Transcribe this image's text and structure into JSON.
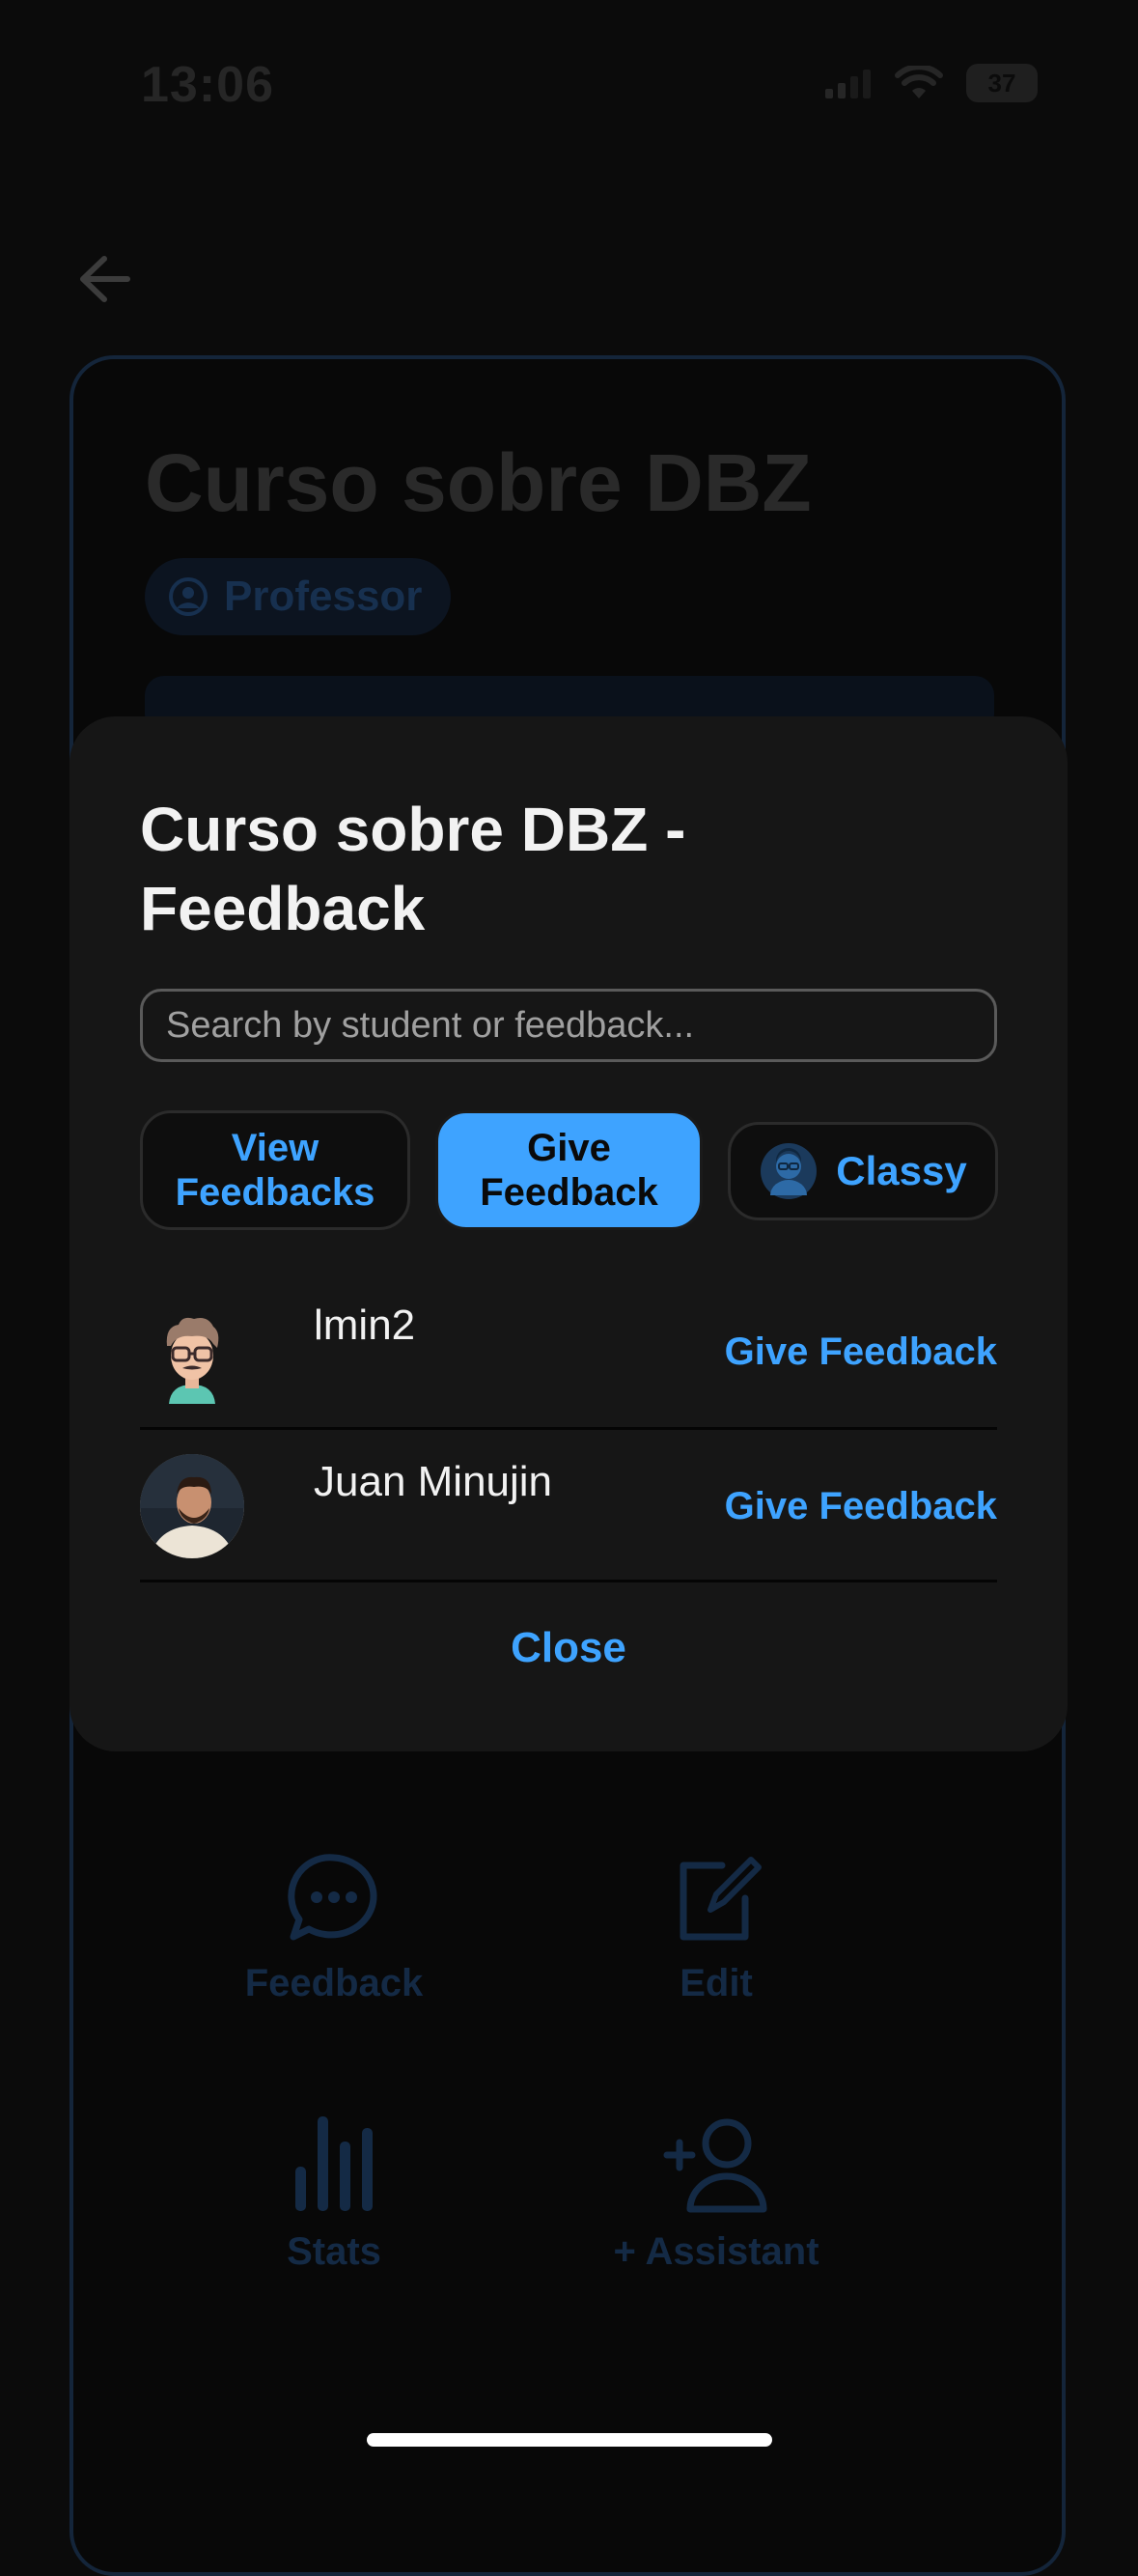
{
  "status_bar": {
    "time": "13:06",
    "battery": "37"
  },
  "course_card": {
    "title": "Curso sobre DBZ",
    "role_chip": "Professor",
    "actions": [
      {
        "label": "Feedback",
        "icon": "chat-bubble-icon"
      },
      {
        "label": "Edit",
        "icon": "edit-icon"
      },
      {
        "label": "Stats",
        "icon": "bar-chart-icon"
      },
      {
        "label": "+ Assistant",
        "icon": "add-user-icon"
      }
    ]
  },
  "modal": {
    "title": "Curso sobre DBZ - Feedback",
    "search": {
      "placeholder": "Search by student or feedback...",
      "value": ""
    },
    "tabs": [
      {
        "label": "View Feedbacks",
        "active": false
      },
      {
        "label": "Give Feedback",
        "active": true
      },
      {
        "label": "Classy",
        "active": false,
        "icon": "assistant-avatar-icon"
      }
    ],
    "students": [
      {
        "name": "lmin2",
        "action": "Give Feedback",
        "avatar": "cartoon-avatar"
      },
      {
        "name": "Juan Minujin",
        "action": "Give Feedback",
        "avatar": "photo-avatar"
      }
    ],
    "close_label": "Close"
  },
  "colors": {
    "accent": "#3EA3FF",
    "modal_bg": "#161616",
    "page_bg": "#0B0B0B"
  }
}
